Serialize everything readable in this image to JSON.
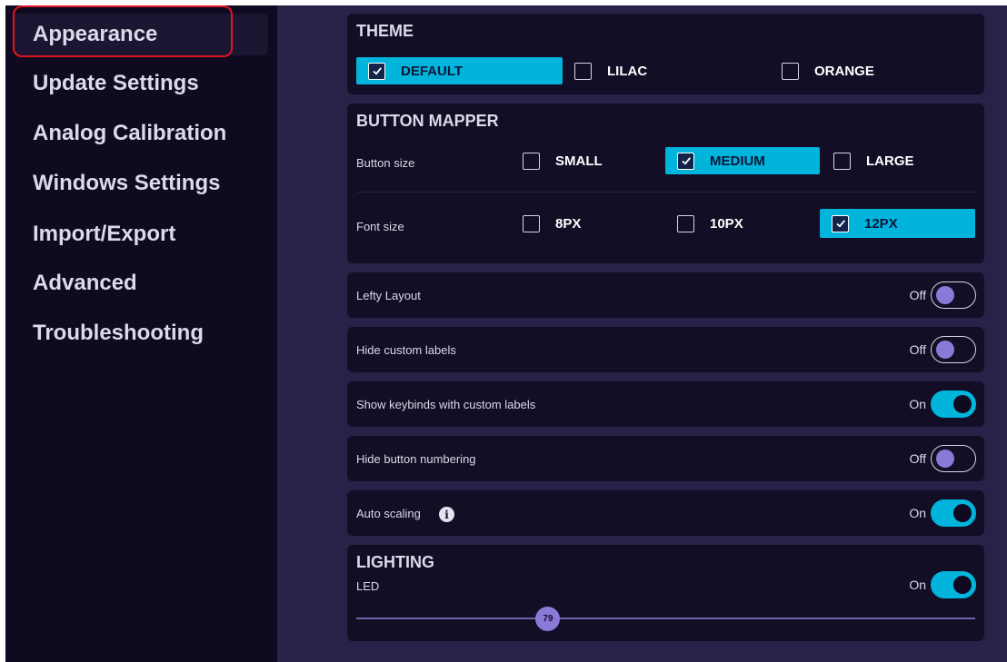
{
  "sidebar": {
    "items": [
      {
        "label": "Appearance",
        "active": true
      },
      {
        "label": "Update Settings"
      },
      {
        "label": "Analog Calibration"
      },
      {
        "label": "Windows Settings"
      },
      {
        "label": "Import/Export"
      },
      {
        "label": "Advanced"
      },
      {
        "label": "Troubleshooting"
      }
    ]
  },
  "theme": {
    "title": "THEME",
    "options": [
      {
        "label": "DEFAULT",
        "checked": true
      },
      {
        "label": "LILAC",
        "checked": false
      },
      {
        "label": "ORANGE",
        "checked": false
      }
    ]
  },
  "button_mapper": {
    "title": "BUTTON MAPPER",
    "button_size": {
      "label": "Button size",
      "options": [
        {
          "label": "SMALL",
          "checked": false
        },
        {
          "label": "MEDIUM",
          "checked": true
        },
        {
          "label": "LARGE",
          "checked": false
        }
      ]
    },
    "font_size": {
      "label": "Font size",
      "options": [
        {
          "label": "8PX",
          "checked": false
        },
        {
          "label": "10PX",
          "checked": false
        },
        {
          "label": "12PX",
          "checked": true
        }
      ]
    }
  },
  "toggles": [
    {
      "label": "Lefty Layout",
      "state": "Off",
      "on": false
    },
    {
      "label": "Hide custom labels",
      "state": "Off",
      "on": false
    },
    {
      "label": "Show keybinds with custom labels",
      "state": "On",
      "on": true
    },
    {
      "label": "Hide button numbering",
      "state": "Off",
      "on": false
    },
    {
      "label": "Auto scaling",
      "state": "On",
      "on": true,
      "info_icon": "info-icon"
    }
  ],
  "lighting": {
    "title": "LIGHTING",
    "led_label": "LED",
    "led_state": "On",
    "led_on": true,
    "brightness": 79,
    "brightness_max": 255
  },
  "colors": {
    "accent": "#00b4dc",
    "sidebar_bg": "#100a20",
    "content_bg": "#2a2148",
    "panel_bg": "#130d25",
    "knob": "#8b79d8",
    "highlight_outline": "#e0141e"
  }
}
